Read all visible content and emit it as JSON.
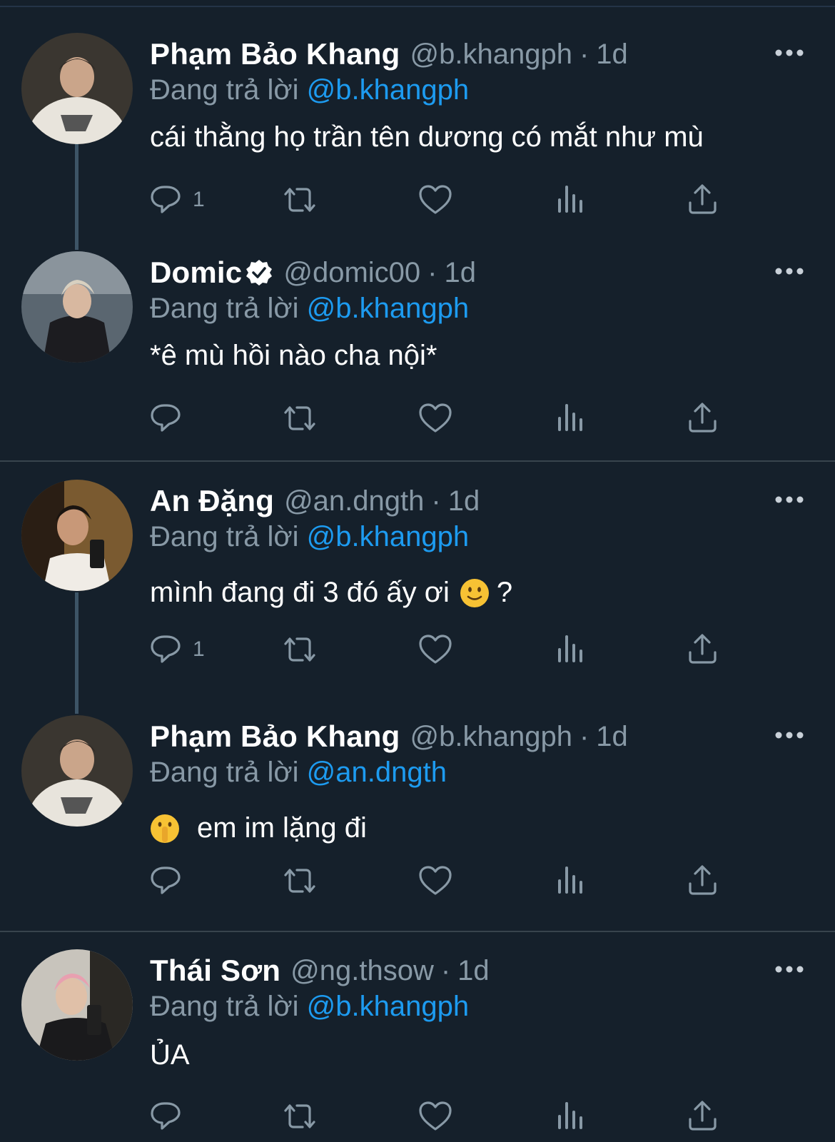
{
  "colors": {
    "background": "#15202b",
    "text": "#ffffff",
    "muted": "#8899a6",
    "mention": "#1d9bf0",
    "separator": "#38444d"
  },
  "replying_label": "Đang trả lời",
  "tweets": [
    {
      "name": "Phạm Bảo Khang",
      "handle": "@b.khangph",
      "separator": "·",
      "time": "1d",
      "reply_to": "@b.khangph",
      "text": "cái thằng họ trần tên dương có mắt như mù",
      "reply_count": "1",
      "verified": false,
      "avatar": "avatar-photo"
    },
    {
      "name": "Domic",
      "handle": "@domic00",
      "separator": "·",
      "time": "1d",
      "reply_to": "@b.khangph",
      "text": "*ê mù hồi nào cha nội*",
      "reply_count": "",
      "verified": true,
      "avatar": "avatar-photo"
    },
    {
      "name": "An Đặng",
      "handle": "@an.dngth",
      "separator": "·",
      "time": "1d",
      "reply_to": "@b.khangph",
      "text_before": "mình đang đi 3 đó ấy ơi",
      "emoji": "slightly-smiling-face",
      "text_after": "?",
      "reply_count": "1",
      "verified": false,
      "avatar": "avatar-photo"
    },
    {
      "name": "Phạm Bảo Khang",
      "handle": "@b.khangph",
      "separator": "·",
      "time": "1d",
      "reply_to": "@an.dngth",
      "emoji": "shushing-face",
      "text_after": "em im lặng đi",
      "reply_count": "",
      "verified": false,
      "avatar": "avatar-photo"
    },
    {
      "name": "Thái Sơn",
      "handle": "@ng.thsow",
      "separator": "·",
      "time": "1d",
      "reply_to": "@b.khangph",
      "text": "ỦA",
      "reply_count": "",
      "verified": false,
      "avatar": "avatar-photo"
    }
  ],
  "action_icons": [
    "reply-icon",
    "retweet-icon",
    "like-icon",
    "views-icon",
    "share-icon"
  ]
}
